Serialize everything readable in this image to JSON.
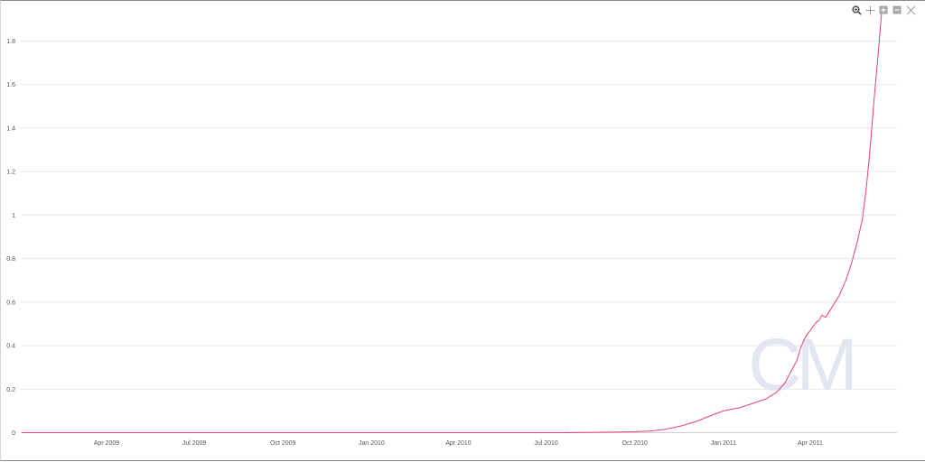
{
  "toolbar": {
    "icons": [
      "zoom-icon",
      "pan-icon",
      "zoom-in-icon",
      "zoom-out-icon",
      "reset-icon"
    ]
  },
  "watermark": {
    "text": "CM"
  },
  "colors": {
    "line": "#e8436e",
    "grid": "#e9e9e9",
    "text": "#555555",
    "watermark": "#e3e5f2",
    "toolbar": "#8c8c8c"
  },
  "chart_data": {
    "type": "line",
    "title": "",
    "xlabel": "",
    "ylabel": "",
    "ylim": [
      0,
      1.8
    ],
    "yticks": [
      0,
      0.2,
      0.4,
      0.6,
      0.8,
      1,
      1.2,
      1.4,
      1.6,
      1.8
    ],
    "yticklabels": [
      "0",
      "0.2",
      "0.4",
      "0.6",
      "0.8",
      "1",
      "1.2",
      "1.4",
      "1.6",
      "1.8"
    ],
    "xlim": [
      "2009-01-02",
      "2011-06-30"
    ],
    "xticks": [
      "2009-04-01",
      "2009-07-01",
      "2009-10-01",
      "2010-01-01",
      "2010-04-01",
      "2010-07-01",
      "2010-10-01",
      "2011-01-01",
      "2011-04-01"
    ],
    "xticklabels": [
      "Apr 2009",
      "Jul 2009",
      "Oct 2009",
      "Jan 2010",
      "Apr 2010",
      "Jul 2010",
      "Oct 2010",
      "Jan 2011",
      "Apr 2011"
    ],
    "grid": true,
    "legend": "none",
    "series": [
      {
        "x": [
          "2009-01-03",
          "2009-07-01",
          "2010-01-01",
          "2010-07-17",
          "2010-08-31",
          "2010-09-30",
          "2010-10-18",
          "2010-11-01",
          "2010-11-17",
          "2010-12-03",
          "2010-12-17",
          "2011-01-01",
          "2011-01-18",
          "2011-02-01",
          "2011-02-14",
          "2011-02-25",
          "2011-03-06",
          "2011-03-13",
          "2011-03-18",
          "2011-03-22",
          "2011-03-27",
          "2011-04-01",
          "2011-04-06",
          "2011-04-08",
          "2011-04-10",
          "2011-04-13",
          "2011-04-17",
          "2011-04-24",
          "2011-05-01",
          "2011-05-08",
          "2011-05-14",
          "2011-05-20",
          "2011-05-25",
          "2011-05-29",
          "2011-06-02",
          "2011-06-06",
          "2011-06-10",
          "2011-06-12",
          "2011-06-14"
        ],
        "y": [
          0,
          0,
          0,
          0,
          0.002,
          0.004,
          0.008,
          0.015,
          0.03,
          0.05,
          0.075,
          0.1,
          0.115,
          0.135,
          0.155,
          0.185,
          0.23,
          0.29,
          0.33,
          0.39,
          0.44,
          0.47,
          0.5,
          0.51,
          0.515,
          0.54,
          0.53,
          0.58,
          0.63,
          0.7,
          0.78,
          0.88,
          0.98,
          1.12,
          1.3,
          1.52,
          1.72,
          1.82,
          1.93
        ]
      }
    ]
  }
}
